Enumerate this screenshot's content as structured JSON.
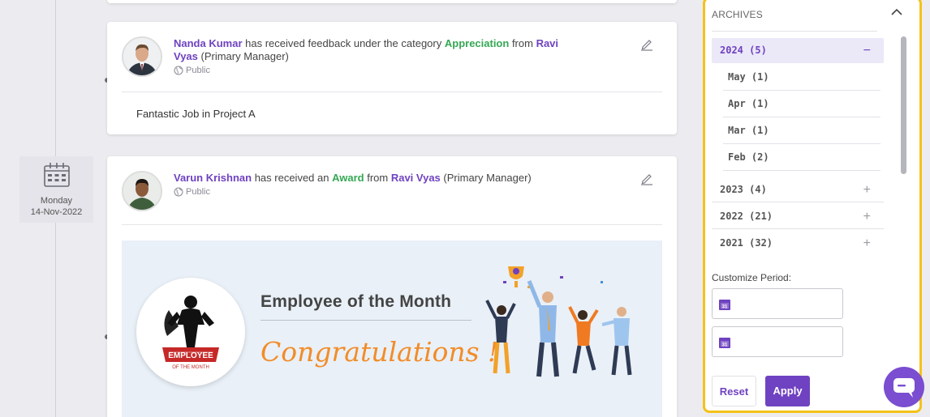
{
  "timeline": {
    "date_day": "Monday",
    "date_value": "14-Nov-2022"
  },
  "feed": [
    {
      "name_part1": "Nanda Kumar",
      "text1": " has received feedback under the category ",
      "category": "Appreciation",
      "text2": " from ",
      "manager_part1": "Ravi",
      "manager_part2": "Vyas",
      "manager_role": " (Primary Manager)",
      "visibility": "Public",
      "message": "Fantastic Job in Project A"
    },
    {
      "name": "Varun Krishnan",
      "text1": " has received an ",
      "category": "Award",
      "text2": " from ",
      "manager": "Ravi Vyas",
      "manager_role": " (Primary Manager)",
      "visibility": "Public",
      "banner_title": "Employee of the Month",
      "banner_subtitle": "Congratulations !",
      "badge_text": "EMPLOYEE",
      "badge_ribbon": "OF THE MONTH"
    }
  ],
  "archives": {
    "title": "ARCHIVES",
    "years": [
      {
        "label": "2024 (5)",
        "toggle": "−",
        "months": [
          "May (1)",
          "Apr (1)",
          "Mar (1)",
          "Feb (2)"
        ]
      },
      {
        "label": "2023 (4)",
        "toggle": "+"
      },
      {
        "label": "2022 (21)",
        "toggle": "+"
      },
      {
        "label": "2021 (32)",
        "toggle": "+"
      }
    ],
    "customize_label": "Customize Period:",
    "reset_label": "Reset",
    "apply_label": "Apply"
  },
  "colors": {
    "accent": "#6f42c1",
    "highlight_border": "#f4c21a",
    "category_green": "#34a853",
    "congrats_orange": "#f28c28"
  }
}
